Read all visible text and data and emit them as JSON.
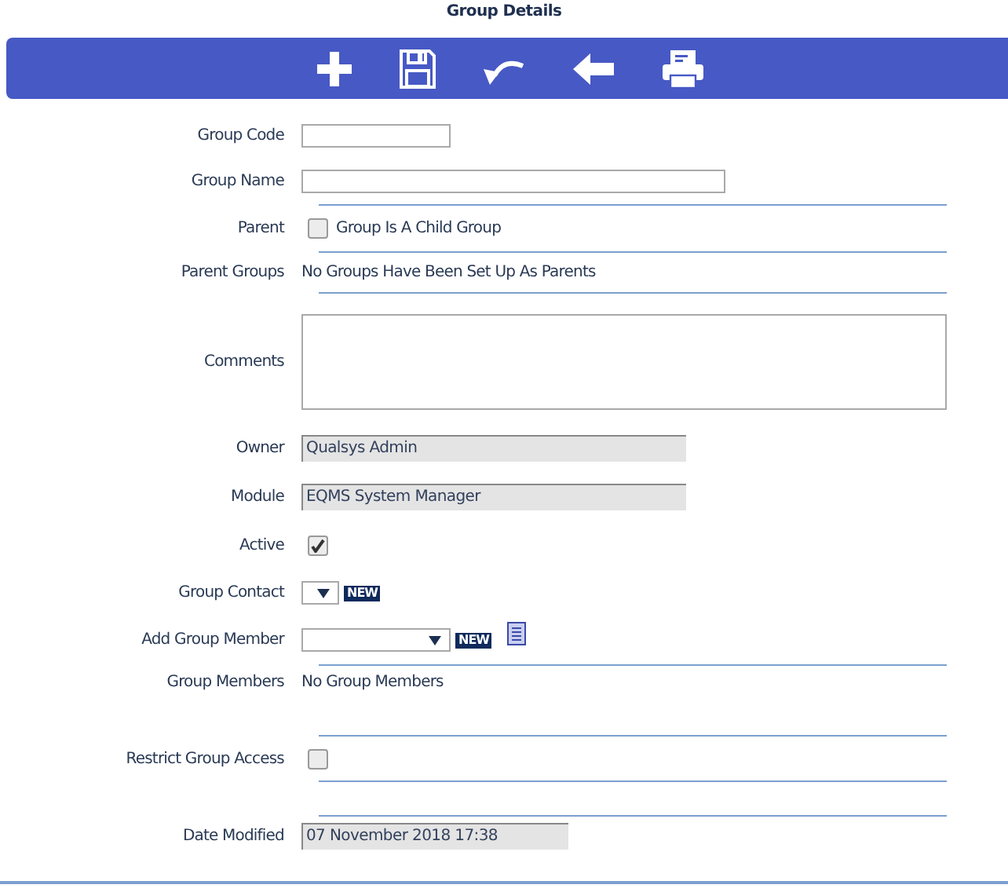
{
  "title": "Group Details",
  "toolbar": [
    {
      "kind": "add"
    },
    {
      "kind": "save"
    },
    {
      "kind": "undo"
    },
    {
      "kind": "back"
    },
    {
      "kind": "print"
    }
  ],
  "group_code": {
    "label": "Group Code"
  },
  "group_name": {
    "label": "Group Name"
  },
  "parent": {
    "label": "Parent",
    "checkbox_label": "Group Is A Child Group",
    "checked": false
  },
  "parent_groups": {
    "label": "Parent Groups",
    "text": "No Groups Have Been Set Up As Parents"
  },
  "comments": {
    "label": "Comments"
  },
  "owner": {
    "label": "Owner",
    "value": "Qualsys Admin"
  },
  "module": {
    "label": "Module",
    "value": "EQMS System Manager"
  },
  "active": {
    "label": "Active",
    "checked": true
  },
  "group_contact": {
    "label": "Group Contact",
    "badge": "NEW"
  },
  "add_group_member": {
    "label": "Add Group Member",
    "badge": "NEW"
  },
  "group_members": {
    "label": "Group Members",
    "text": "No Group Members"
  },
  "restrict_group_access": {
    "label": "Restrict Group Access",
    "checked": false
  },
  "date_modified": {
    "label": "Date Modified",
    "value": "07 November 2018 17:38"
  }
}
